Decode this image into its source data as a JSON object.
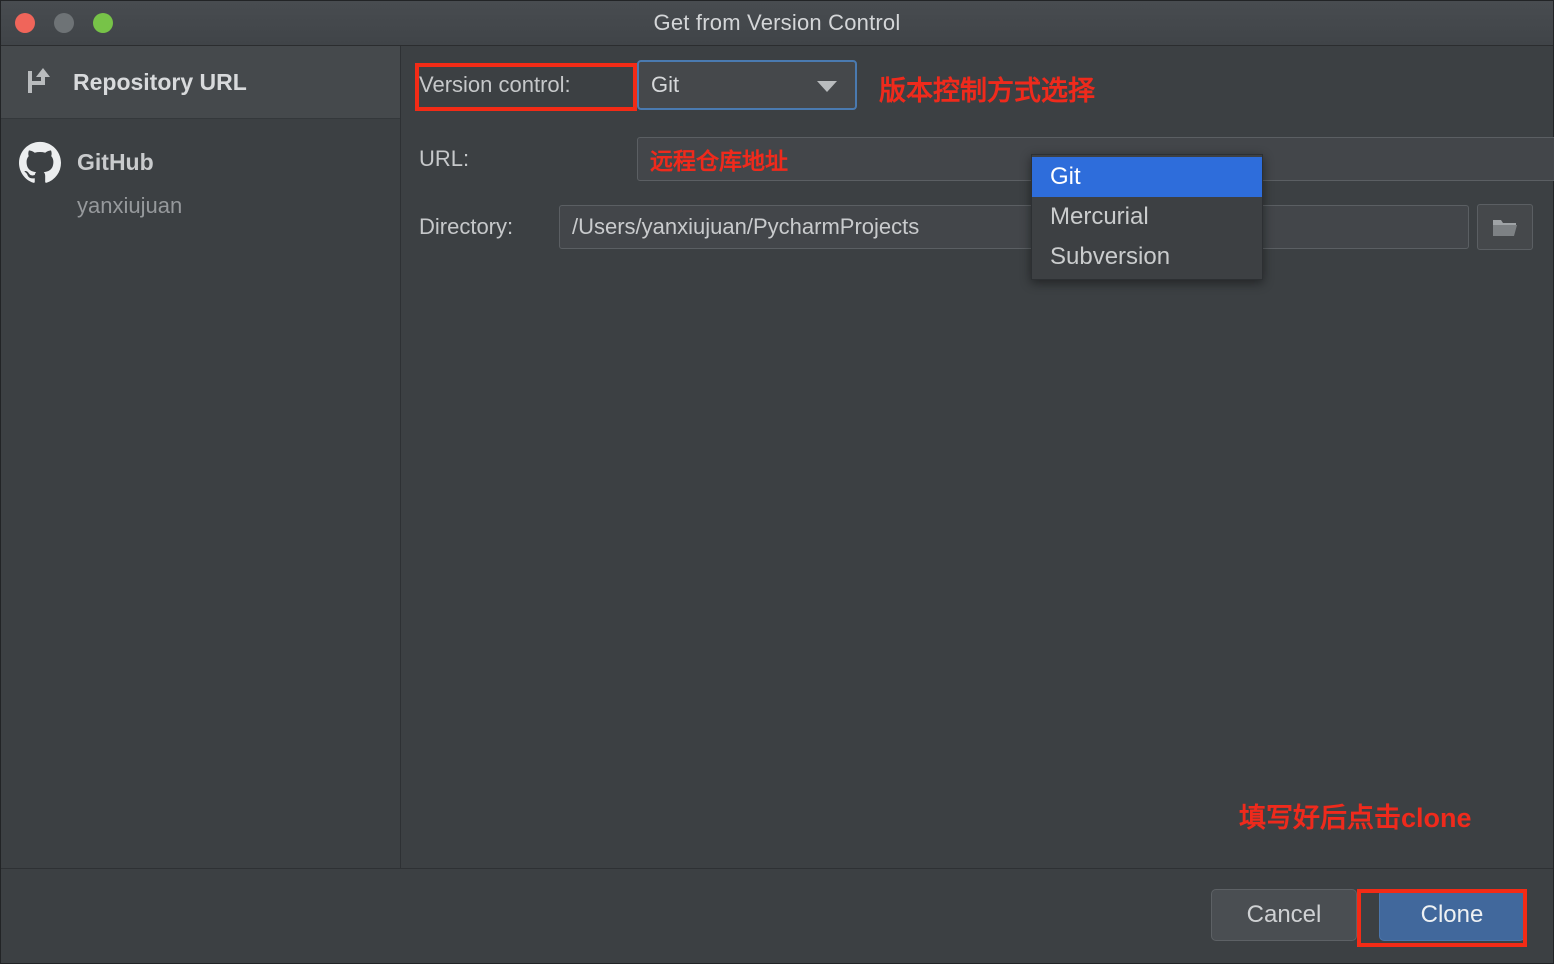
{
  "window": {
    "title": "Get from Version Control",
    "traffic_lights": [
      "close-button",
      "minimize-button",
      "zoom-button"
    ]
  },
  "sidebar": {
    "header": {
      "icon": "vcs-branch-icon",
      "label": "Repository URL"
    },
    "accounts": [
      {
        "icon": "github-icon",
        "name": "GitHub",
        "user": "yanxiujuan"
      }
    ]
  },
  "form": {
    "version_control": {
      "label": "Version control:",
      "value": "Git",
      "caret_icon": "chevron-down-icon",
      "options": [
        "Git",
        "Mercurial",
        "Subversion"
      ],
      "selected_option": "Git"
    },
    "url": {
      "label": "URL:",
      "value": "",
      "placeholder": ""
    },
    "directory": {
      "label": "Directory:",
      "value": "/Users/yanxiujuan/PycharmProjects",
      "browse_icon": "folder-icon"
    }
  },
  "annotations": [
    {
      "id": "vc-note",
      "text": "版本控制方式选择"
    },
    {
      "id": "url-note",
      "text": "远程仓库地址"
    },
    {
      "id": "clone-note",
      "text": "填写好后点击clone"
    }
  ],
  "footer": {
    "cancel_label": "Cancel",
    "clone_label": "Clone"
  },
  "colors": {
    "annotation_red": "#ef2a1c",
    "highlight_blue": "#2e6ddb",
    "primary_button": "#41689c",
    "window_bg": "#3c4043"
  }
}
